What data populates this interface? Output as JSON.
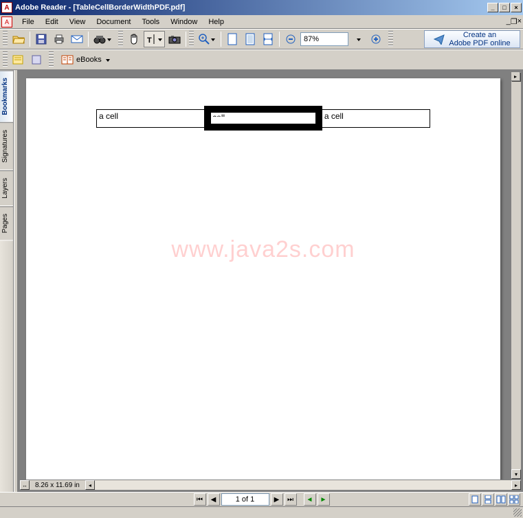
{
  "titlebar": {
    "app_name": "Adobe Reader",
    "document": "[TableCellBorderWidthPDF.pdf]",
    "icon_letter": "A"
  },
  "menubar": {
    "items": [
      "File",
      "Edit",
      "View",
      "Document",
      "Tools",
      "Window",
      "Help"
    ]
  },
  "toolbar1": {
    "zoom_value": "87%",
    "create_pdf_line1": "Create an",
    "create_pdf_line2": "Adobe PDF online"
  },
  "toolbar2": {
    "ebooks_label": "eBooks"
  },
  "side_tabs": {
    "items": [
      "Bookmarks",
      "Signatures",
      "Layers",
      "Pages"
    ],
    "active_index": 0
  },
  "document": {
    "cells": [
      "a cell",
      "cell",
      "a cell"
    ],
    "watermark": "www.java2s.com"
  },
  "hscroll": {
    "page_dimensions": "8.26 x 11.69 in"
  },
  "statusbar": {
    "page_indicator": "1 of 1"
  }
}
